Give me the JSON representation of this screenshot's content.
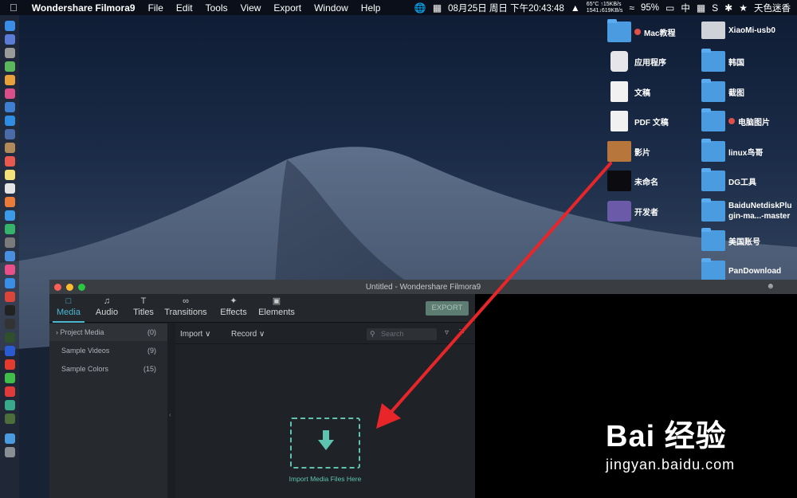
{
  "menubar": {
    "app_name": "Wondershare Filmora9",
    "menus": [
      "File",
      "Edit",
      "Tools",
      "View",
      "Export",
      "Window",
      "Help"
    ],
    "datetime": "08月25日 周日 下午20:43:48",
    "net_top": "65°C  ↑15KB/s",
    "net_bottom": "1541↓619KB/s",
    "battery": "95%",
    "input_method": "中",
    "user": "天色迷香"
  },
  "desktop_icons": {
    "col1": [
      "Mac教程",
      "应用程序",
      "文稿",
      "PDF 文稿",
      "影片",
      "未命名",
      "开发者"
    ],
    "col2": [
      "XiaoMi-usb0",
      "韩国",
      "截图",
      "电脑图片",
      "linux鸟哥",
      "DG工具",
      "BaiduNetdiskPlu",
      "gin-ma...-master",
      "美国账号",
      "PanDownload"
    ]
  },
  "window": {
    "title": "Untitled - Wondershare Filmora9",
    "tabs": [
      "Media",
      "Audio",
      "Titles",
      "Transitions",
      "Effects",
      "Elements"
    ],
    "export_label": "EXPORT",
    "sidebar": [
      {
        "label": "Project Media",
        "count": "(0)"
      },
      {
        "label": "Sample Videos",
        "count": "(9)"
      },
      {
        "label": "Sample Colors",
        "count": "(15)"
      }
    ],
    "import_label": "Import",
    "record_label": "Record",
    "search_placeholder": "Search",
    "drop_label": "Import Media Files Here"
  },
  "watermark": {
    "brand": "Bai 经验",
    "url": "jingyan.baidu.com"
  },
  "colors": {
    "accent": "#4cb6d0",
    "drop_accent": "#5ec4b0",
    "annotation_arrow": "#e8262a"
  }
}
